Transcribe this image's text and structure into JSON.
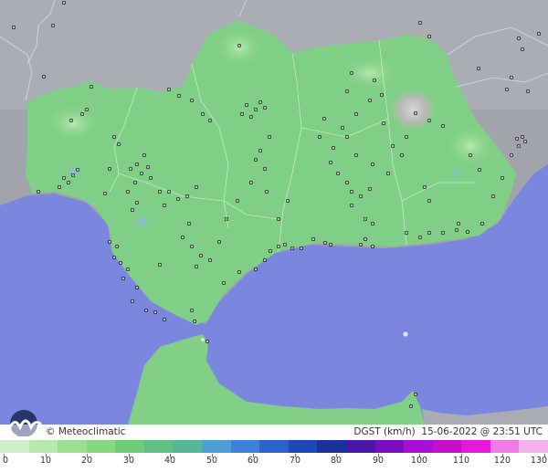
{
  "attribution": "© Meteoclimatic",
  "variable_label": "DGST (km/h)",
  "timestamp": "15-06-2022 @ 23:51 UTC",
  "legend": {
    "ticks": [
      "0",
      "10",
      "20",
      "30",
      "40",
      "50",
      "60",
      "70",
      "80",
      "90",
      "100",
      "110",
      "120",
      "130"
    ],
    "colors": [
      "#cfeec8",
      "#b8e9ae",
      "#9be08f",
      "#86d880",
      "#6fcc76",
      "#5fc084",
      "#58b698",
      "#4f9fd7",
      "#3c82d6",
      "#2c63c9",
      "#1e48b6",
      "#1a3297",
      "#4a16a8",
      "#7a0fbf",
      "#a70fd6",
      "#c70fc9",
      "#e51ad9",
      "#f07ae8",
      "#f4b2ef"
    ]
  },
  "colors": {
    "sea": "#7b86de",
    "land_main": "#7fcf86",
    "land_light": "#9adb95",
    "outside": "#9fa3aa",
    "station": "#222222"
  }
}
